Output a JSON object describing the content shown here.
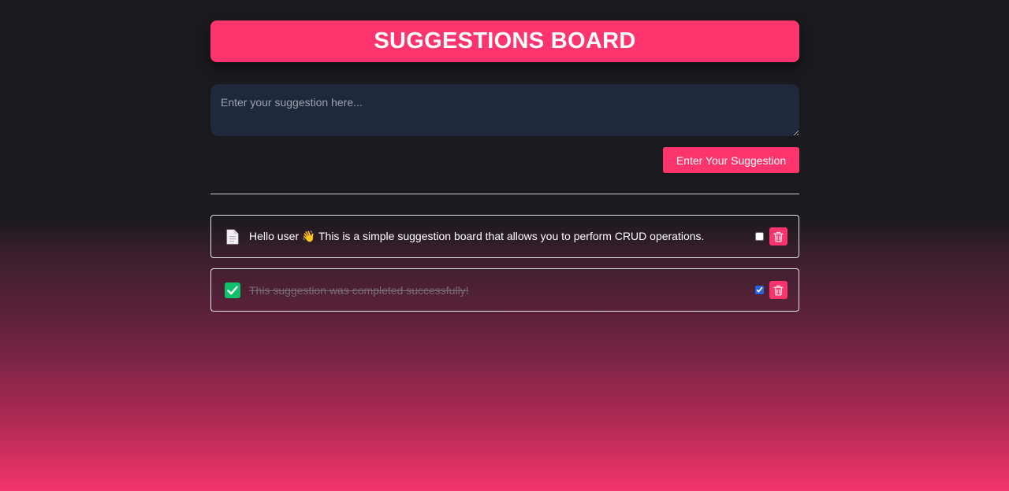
{
  "header": {
    "title": "SUGGESTIONS BOARD"
  },
  "input": {
    "value": "",
    "placeholder": "Enter your suggestion here..."
  },
  "submit_button": {
    "label": "Enter Your Suggestion"
  },
  "suggestions": [
    {
      "icon": "document-icon",
      "text": "Hello user 👋 This is a simple suggestion board that allows you to perform CRUD operations.",
      "completed": false
    },
    {
      "icon": "check-mark-icon",
      "text": "This suggestion was completed successfully!",
      "completed": true
    }
  ],
  "colors": {
    "accent": "#fe346e",
    "input_bg": "#1e293b",
    "background_top": "#1a191e",
    "background_bottom": "#f4346c",
    "done_icon": "#10b981"
  }
}
